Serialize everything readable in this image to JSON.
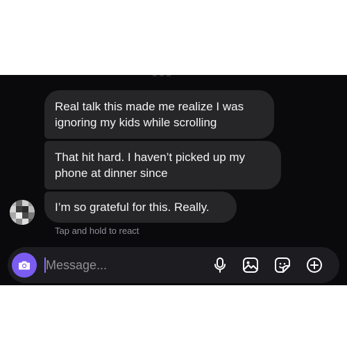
{
  "conversation": {
    "messages": [
      {
        "text": "Real talk this made me realize I was\nignoring my kids while scrolling"
      },
      {
        "text": "That hit hard. I haven’t picked up my\nphone at dinner since"
      },
      {
        "text": "I’m so grateful for this. Really."
      }
    ],
    "react_hint": "Tap and hold to react"
  },
  "composer": {
    "placeholder": "Message...",
    "icons": [
      "camera-icon",
      "microphone-icon",
      "gallery-icon",
      "sticker-icon",
      "add-icon"
    ]
  },
  "colors": {
    "background": "#0a0a0d",
    "bubble": "#262629",
    "accent": "#7b5cf0"
  }
}
